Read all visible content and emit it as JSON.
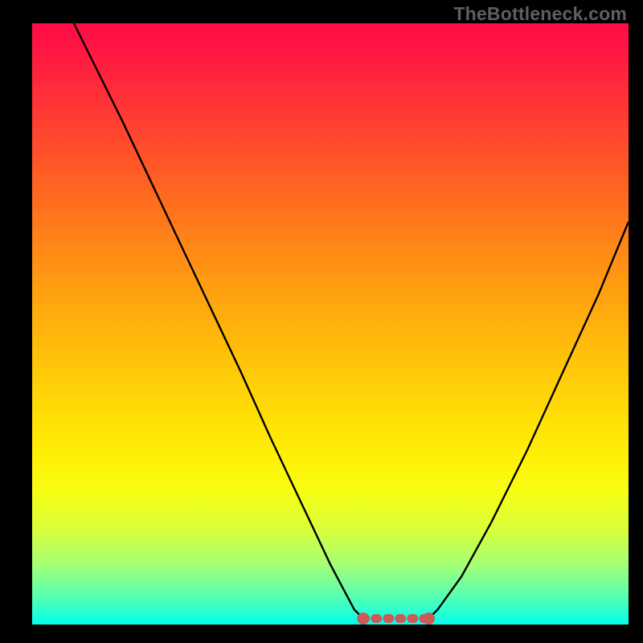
{
  "watermark": "TheBottleneck.com",
  "colors": {
    "frame": "#000000",
    "curve": "#000000",
    "trough_mark": "#cc5a57",
    "gradient_stops": [
      "#ff0b47",
      "#ff1842",
      "#ff3a33",
      "#ff6e1e",
      "#ffa210",
      "#ffcf07",
      "#fff005",
      "#f6fe14",
      "#daff3a",
      "#a4ff74",
      "#5cffad",
      "#14ffe0",
      "#00fff4"
    ]
  },
  "chart_data": {
    "type": "line",
    "title": "",
    "xlabel": "",
    "ylabel": "",
    "xlim": [
      0,
      100
    ],
    "ylim": [
      0,
      100
    ],
    "grid": false,
    "legend": false,
    "series": [
      {
        "name": "left-branch",
        "x": [
          7,
          10,
          15,
          20,
          25,
          30,
          35,
          40,
          45,
          50,
          54,
          55.5
        ],
        "values": [
          100,
          94,
          84,
          73.5,
          63,
          52.5,
          42,
          31,
          20.5,
          10,
          2.5,
          1
        ]
      },
      {
        "name": "right-branch",
        "x": [
          66.5,
          68,
          72,
          77,
          83,
          89,
          95,
          100
        ],
        "values": [
          1,
          2.5,
          8,
          17,
          29,
          42,
          55,
          67
        ]
      }
    ],
    "trough": {
      "name": "bottleneck-trough-marker",
      "x_start": 55.5,
      "x_end": 66.5,
      "y": 1,
      "style": "thick-dotted",
      "color": "#cc5a57"
    }
  }
}
